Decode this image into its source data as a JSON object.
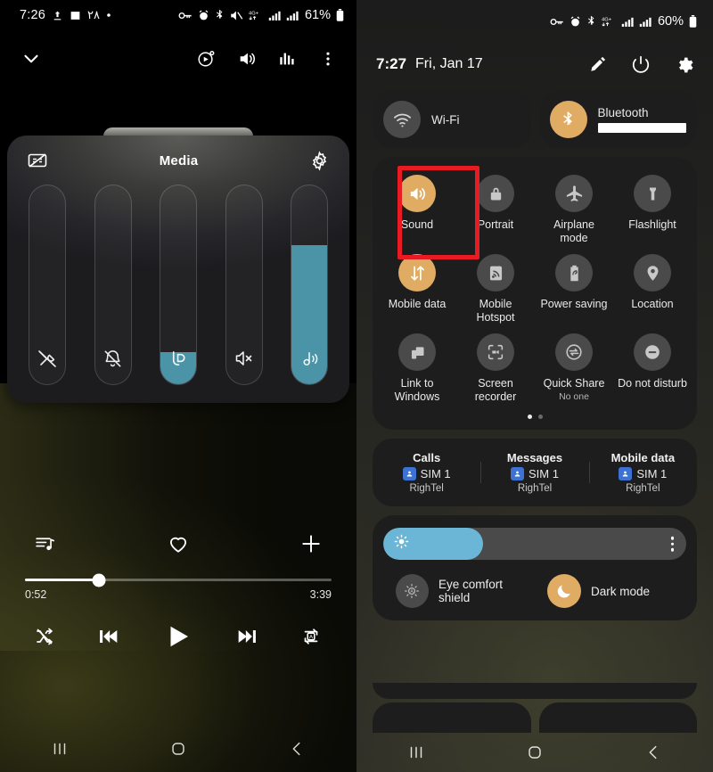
{
  "left_phone": {
    "status_bar": {
      "time": "7:26",
      "left_icons": [
        "upload-icon",
        "image-icon",
        "notification-count",
        "dot-icon"
      ],
      "notification_count": "۲۸",
      "right_icons": [
        "vpn-key-icon",
        "alarm-icon",
        "bluetooth-icon",
        "mute-icon",
        "4g-plus-icon",
        "signal-icon",
        "signal-icon"
      ],
      "network_label": "4G+",
      "battery_percent": "61%"
    },
    "header": {
      "collapse_icon": "chevron-down-icon",
      "actions": [
        "spatial-audio-icon",
        "volume-icon",
        "equalizer-icon",
        "more-vertical-icon"
      ]
    },
    "volume_panel": {
      "title": "Media",
      "left_icon": "captions-off-icon",
      "right_icon": "gear-icon",
      "active_color": "#4b93a6",
      "sliders": [
        {
          "name": "call-volume",
          "icon": "tool-off-icon",
          "level": 0
        },
        {
          "name": "notification-volume",
          "icon": "bell-off-icon",
          "level": 0
        },
        {
          "name": "bixby-volume",
          "icon": "bixby-icon",
          "level": 16
        },
        {
          "name": "system-volume",
          "icon": "speaker-mute-icon",
          "level": 0
        },
        {
          "name": "media-volume",
          "icon": "music-note-icon",
          "level": 70
        }
      ]
    },
    "media_player": {
      "actions": [
        "playlist-icon",
        "heart-icon",
        "plus-icon"
      ],
      "progress_percent": 24,
      "current_time": "0:52",
      "total_time": "3:39",
      "transport": [
        "shuffle-off-icon",
        "previous-icon",
        "play-icon",
        "next-icon",
        "repeat-one-icon"
      ]
    },
    "nav_bar": [
      "recents-icon",
      "home-icon",
      "back-icon"
    ]
  },
  "right_phone": {
    "status_bar": {
      "right_icons": [
        "vpn-key-icon",
        "alarm-icon",
        "bluetooth-icon",
        "4g-plus-icon",
        "signal-icon",
        "signal-icon"
      ],
      "network_label": "4G+",
      "battery_percent": "60%"
    },
    "quick_header": {
      "time": "7:27",
      "date": "Fri, Jan 17",
      "actions": [
        "edit-pencil-icon",
        "power-icon",
        "gear-icon"
      ]
    },
    "connectivity": [
      {
        "name": "wifi",
        "icon": "wifi-icon",
        "label": "Wi-Fi",
        "active": false,
        "redacted": false
      },
      {
        "name": "bluetooth",
        "icon": "bluetooth-icon",
        "label": "Bluetooth",
        "active": true,
        "redacted": true
      }
    ],
    "tiles": [
      {
        "name": "sound",
        "icon": "volume-icon",
        "label": "Sound",
        "sub": "",
        "active": true,
        "highlighted": true
      },
      {
        "name": "portrait",
        "icon": "rotation-lock-icon",
        "label": "Portrait",
        "sub": "",
        "active": false,
        "highlighted": false
      },
      {
        "name": "airplane-mode",
        "icon": "airplane-icon",
        "label": "Airplane mode",
        "sub": "",
        "active": false,
        "highlighted": false
      },
      {
        "name": "flashlight",
        "icon": "flashlight-icon",
        "label": "Flashlight",
        "sub": "",
        "active": false,
        "highlighted": false
      },
      {
        "name": "mobile-data",
        "icon": "data-transfer-icon",
        "label": "Mobile data",
        "sub": "",
        "active": true,
        "highlighted": false
      },
      {
        "name": "mobile-hotspot",
        "icon": "hotspot-icon",
        "label": "Mobile Hotspot",
        "sub": "",
        "active": false,
        "highlighted": false
      },
      {
        "name": "power-saving",
        "icon": "battery-leaf-icon",
        "label": "Power saving",
        "sub": "",
        "active": false,
        "highlighted": false
      },
      {
        "name": "location",
        "icon": "location-pin-icon",
        "label": "Location",
        "sub": "",
        "active": false,
        "highlighted": false
      },
      {
        "name": "link-to-windows",
        "icon": "link-devices-icon",
        "label": "Link to Windows",
        "sub": "",
        "active": false,
        "highlighted": false
      },
      {
        "name": "screen-recorder",
        "icon": "screen-record-icon",
        "label": "Screen recorder",
        "sub": "",
        "active": false,
        "highlighted": false
      },
      {
        "name": "quick-share",
        "icon": "quick-share-icon",
        "label": "Quick Share",
        "sub": "No one",
        "active": false,
        "highlighted": false
      },
      {
        "name": "do-not-disturb",
        "icon": "minus-circle-icon",
        "label": "Do not disturb",
        "sub": "",
        "active": false,
        "highlighted": false
      }
    ],
    "page_dots": {
      "count": 2,
      "active_index": 0
    },
    "sim_info": [
      {
        "name": "calls",
        "header": "Calls",
        "sim": "SIM 1",
        "carrier": "RighTel"
      },
      {
        "name": "messages",
        "header": "Messages",
        "sim": "SIM 1",
        "carrier": "RighTel"
      },
      {
        "name": "mobile-data",
        "header": "Mobile data",
        "sim": "SIM 1",
        "carrier": "RighTel"
      }
    ],
    "brightness": {
      "name": "brightness-slider",
      "percent": 33,
      "fill_color": "#6bb6d6",
      "icon": "brightness-sun-icon",
      "menu_icon": "more-vertical-icon"
    },
    "display_toggles": [
      {
        "name": "eye-comfort-shield",
        "icon": "eye-comfort-icon",
        "label": "Eye comfort shield",
        "active": false
      },
      {
        "name": "dark-mode",
        "icon": "moon-icon",
        "label": "Dark mode",
        "active": true
      }
    ],
    "nav_bar": [
      "recents-icon",
      "home-icon",
      "back-icon"
    ],
    "accent_color": "#e0ab63",
    "highlight_color": "#e81b23"
  }
}
